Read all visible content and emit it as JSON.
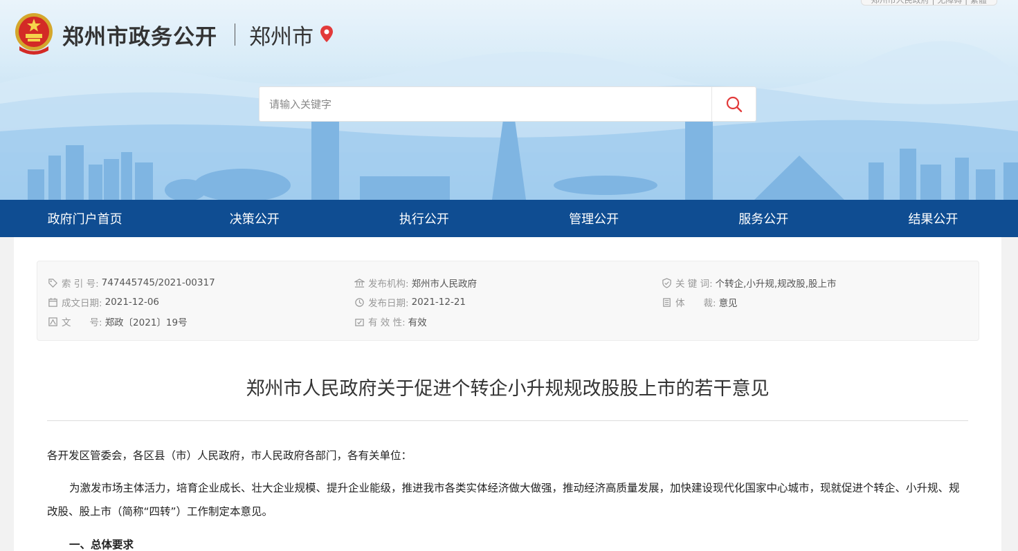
{
  "header": {
    "site_title": "郑州市政务公开",
    "city": "郑州市",
    "topbar_hint": "郑州市人民政府 | 无障碍 | 繁體"
  },
  "search": {
    "placeholder": "请输入关键字"
  },
  "nav": {
    "items": [
      {
        "label": "政府门户首页"
      },
      {
        "label": "决策公开"
      },
      {
        "label": "执行公开"
      },
      {
        "label": "管理公开"
      },
      {
        "label": "服务公开"
      },
      {
        "label": "结果公开"
      }
    ]
  },
  "meta": {
    "index_label": "索 引 号:",
    "index_value": "747445745/2021-00317",
    "created_label": "成文日期:",
    "created_value": "2021-12-06",
    "docno_label": "文　　号:",
    "docno_value": "郑政〔2021〕19号",
    "publisher_label": "发布机构:",
    "publisher_value": "郑州市人民政府",
    "pubdate_label": "发布日期:",
    "pubdate_value": "2021-12-21",
    "validity_label": "有 效 性:",
    "validity_value": "有效",
    "keywords_label": "关 键 词:",
    "keywords_value": "个转企,小升规,规改股,股上市",
    "genre_label": "体　　裁:",
    "genre_value": "意见"
  },
  "article": {
    "title": "郑州市人民政府关于促进个转企小升规规改股股上市的若干意见",
    "salutation": "各开发区管委会，各区县（市）人民政府，市人民政府各部门，各有关单位：",
    "body": "为激发市场主体活力，培育企业成长、壮大企业规模、提升企业能级，推进我市各类实体经济做大做强，推动经济高质量发展，加快建设现代化国家中心城市，现就促进个转企、小升规、规改股、股上市（简称“四转”）工作制定本意见。",
    "section_heading": "一、总体要求"
  },
  "colors": {
    "nav_bg": "#0f4d92",
    "accent_red": "#e23a3a"
  }
}
